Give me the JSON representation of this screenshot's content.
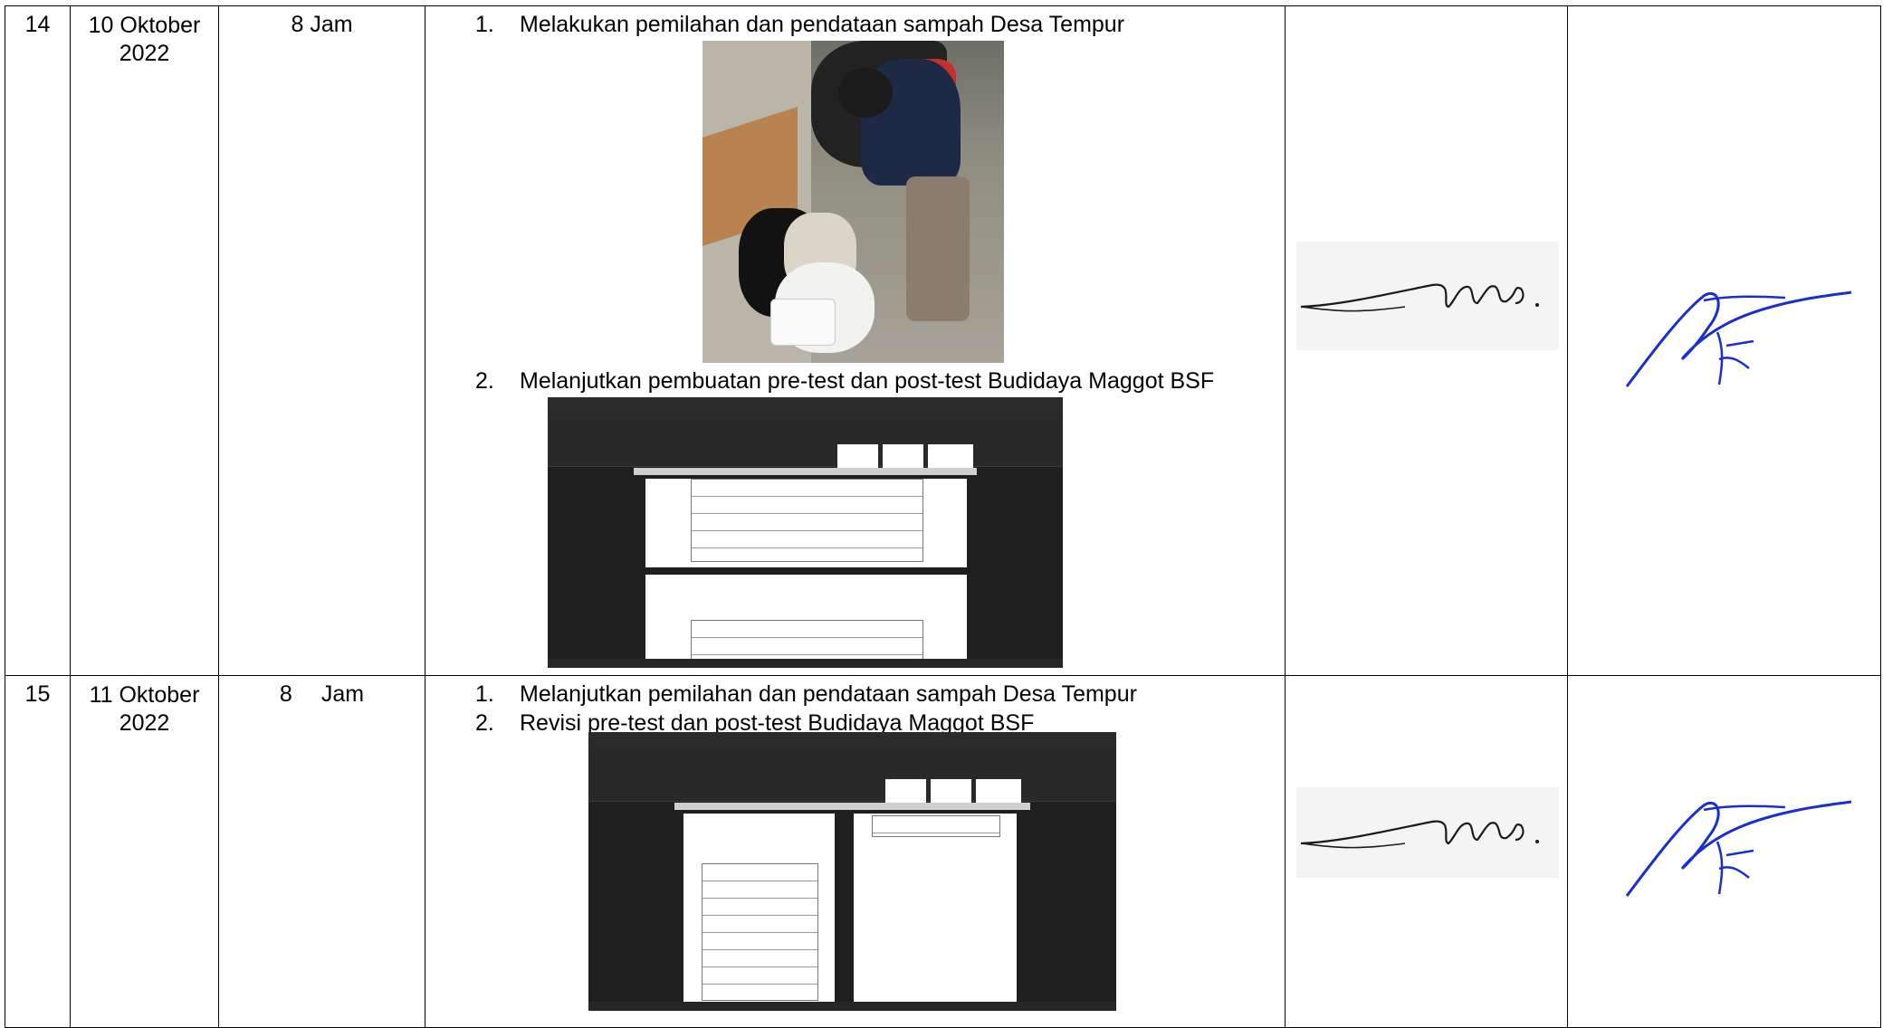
{
  "rows": [
    {
      "no": "14",
      "date_line1": "10 Oktober",
      "date_line2": "2022",
      "duration_number": "8",
      "duration_unit": "Jam",
      "activities": [
        {
          "number": "1.",
          "text": "Melakukan pemilahan dan pendataan sampah Desa Tempur"
        },
        {
          "number": "2.",
          "text": "Melanjutkan pembuatan pre-test dan post-test Budidaya Maggot BSF"
        }
      ]
    },
    {
      "no": "15",
      "date_line1": "11 Oktober",
      "date_line2": "2022",
      "duration_number": "8",
      "duration_unit": "Jam",
      "activities": [
        {
          "number": "1.",
          "text": "Melanjutkan pemilahan dan pendataan sampah Desa Tempur"
        },
        {
          "number": "2.",
          "text": "Revisi pre-test dan post-test Budidaya Maggot BSF"
        }
      ]
    }
  ],
  "colors": {
    "border": "#000000",
    "signature_blue": "#1b2fd0",
    "signature_black": "#1a1a1a"
  }
}
